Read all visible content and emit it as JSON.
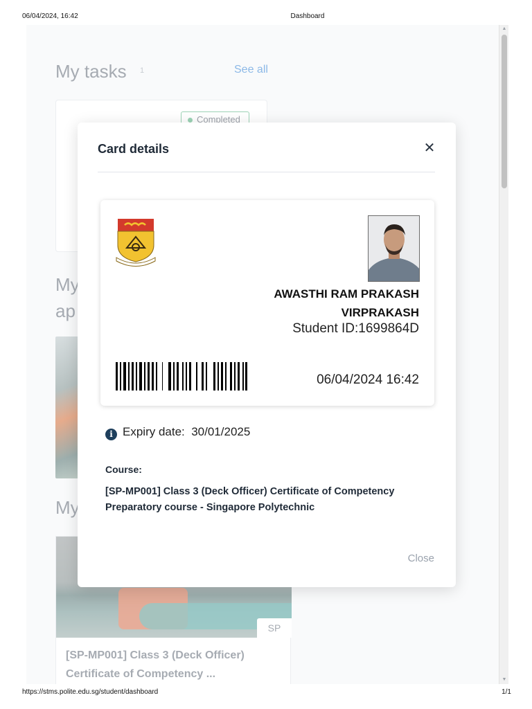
{
  "print": {
    "date": "06/04/2024, 16:42",
    "title": "Dashboard",
    "url": "https://stms.polite.edu.sg/student/dashboard",
    "page": "1/1"
  },
  "background": {
    "tasks_title": "My tasks",
    "tasks_count": "1",
    "see_all": "See all",
    "task_status": "Completed",
    "heading2_lines": [
      "My",
      "ap"
    ],
    "heading3": "My",
    "course_badge": "SP",
    "course_title": "[SP-MP001] Class 3 (Deck Officer) Certificate of Competency ..."
  },
  "modal": {
    "title": "Card details",
    "close_icon": "close-icon",
    "student_name_line1": "AWASTHI RAM PRAKASH",
    "student_name_line2": "VIRPRAKASH",
    "student_id_label": "Student ID:",
    "student_id": "1699864D",
    "card_datetime": "06/04/2024 16:42",
    "expiry_label": "Expiry date:",
    "expiry_value": "30/01/2025",
    "course_label": "Course:",
    "course_name": "[SP-MP001] Class 3 (Deck Officer) Certificate of Competency Preparatory course - Singapore Polytechnic",
    "close_button": "Close"
  },
  "colors": {
    "accent_link": "#2d7fd3",
    "status_green": "#4caf7a",
    "crest_red": "#d33a2c",
    "crest_yellow": "#f2c230",
    "info_icon": "#1e3f5c"
  }
}
